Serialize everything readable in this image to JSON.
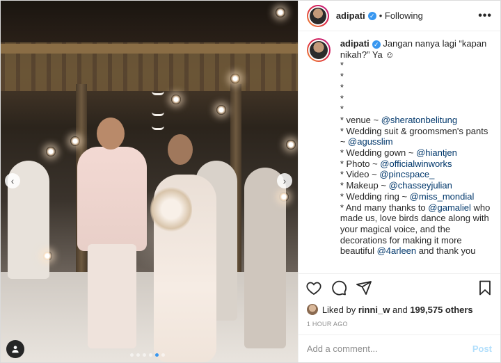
{
  "post": {
    "username": "adipati",
    "following_label": "Following",
    "more_label": "•••",
    "caption": {
      "username": "adipati",
      "intro": "Jangan nanya lagi “kapan nikah?” Ya ☺",
      "dots": [
        "*",
        "*",
        "*",
        "*",
        "*"
      ],
      "lines": [
        {
          "text": "* venue ~ ",
          "link": "@sheratonbelitung"
        },
        {
          "text": "* Wedding suit & groomsmen's pants ~ ",
          "link": "@agusslim"
        },
        {
          "text": "* Wedding gown ~ ",
          "link": "@hiantjen"
        },
        {
          "text": "* Photo ~ ",
          "link": "@officialwinworks"
        },
        {
          "text": "* Video ~ ",
          "link": "@pincspace_"
        },
        {
          "text": "* Makeup ~ ",
          "link": "@chasseyjulian"
        },
        {
          "text": "* Wedding ring ~ ",
          "link": "@miss_mondial"
        }
      ],
      "thanks_prefix": "* And many thanks to ",
      "thanks_link": "@gamaliel",
      "thanks_rest": " who made us, love birds dance along with your magical voice, and the decorations for making it more beautiful ",
      "thanks_link2": "@4arleen",
      "thanks_tail": " and thank you"
    },
    "likes": {
      "prefix": "Liked by ",
      "user": "rinni_w",
      "middle": " and ",
      "count": "199,575 others"
    },
    "timestamp": "1 HOUR AGO",
    "comment": {
      "placeholder": "Add a comment...",
      "post_label": "Post"
    }
  },
  "carousel": {
    "count": 6,
    "active_index": 4
  },
  "colors": {
    "verified": "#3897f0",
    "link": "#00376b",
    "post_disabled": "#b2dffc"
  }
}
